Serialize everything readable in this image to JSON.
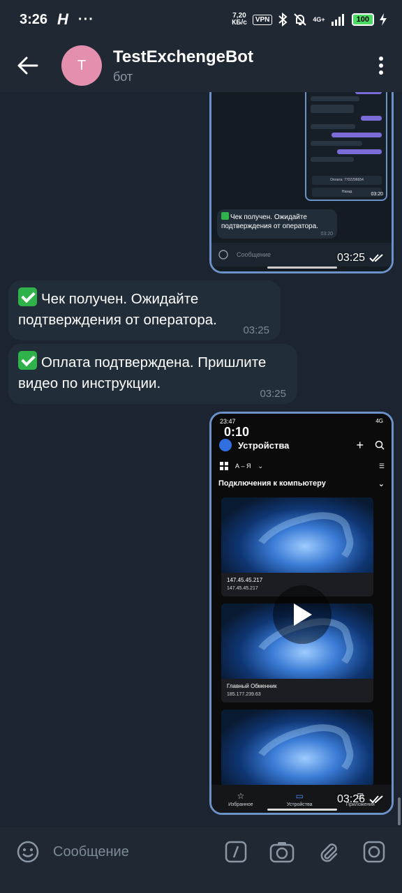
{
  "status_bar": {
    "time": "3:26",
    "carrier_glyph": "H",
    "more": "···",
    "speed_value": "7,20",
    "speed_unit": "КБ/с",
    "vpn": "VPN",
    "network": "4G+",
    "battery": "100"
  },
  "header": {
    "avatar_letter": "T",
    "title": "TestExchengeBot",
    "subtitle": "бот"
  },
  "messages": {
    "screenshot1": {
      "snippet_text": "Чек получен. Ожидайте подтверждения от оператора.",
      "snippet_time": "03:20",
      "mini_time": "03:20",
      "mini_button_1": "Оплата: 7702296654",
      "mini_button_2": "Назад",
      "input_placeholder": "Сообщение",
      "time": "03:25"
    },
    "text1": {
      "text": "Чек получен. Ожидайте подтверждения от оператора.",
      "time": "03:25"
    },
    "text2": {
      "text": "Оплата подтверждена. Пришлите видео по инструкции.",
      "time": "03:25"
    },
    "video": {
      "duration": "0:10",
      "status_time": "23:47",
      "status_right": "4G",
      "title": "Устройства",
      "sort": "А – Я",
      "section": "Подключения к компьютеру",
      "cards": [
        {
          "name": "147.45.45.217",
          "ip": "147.45.45.217"
        },
        {
          "name": "Главный Обменник",
          "ip": "185.177.239.63"
        },
        {
          "name": "",
          "ip": ""
        }
      ],
      "nav_favorites": "Избранное",
      "nav_devices": "Устройства",
      "nav_apps": "Приложения",
      "time": "03:26"
    }
  },
  "input": {
    "placeholder": "Сообщение"
  },
  "colors": {
    "background": "#1b2430",
    "bar": "#1f2833",
    "bubble": "#222d3a",
    "accent_border": "#6c93c7",
    "avatar": "#e58fae",
    "check": "#2fb24a"
  }
}
